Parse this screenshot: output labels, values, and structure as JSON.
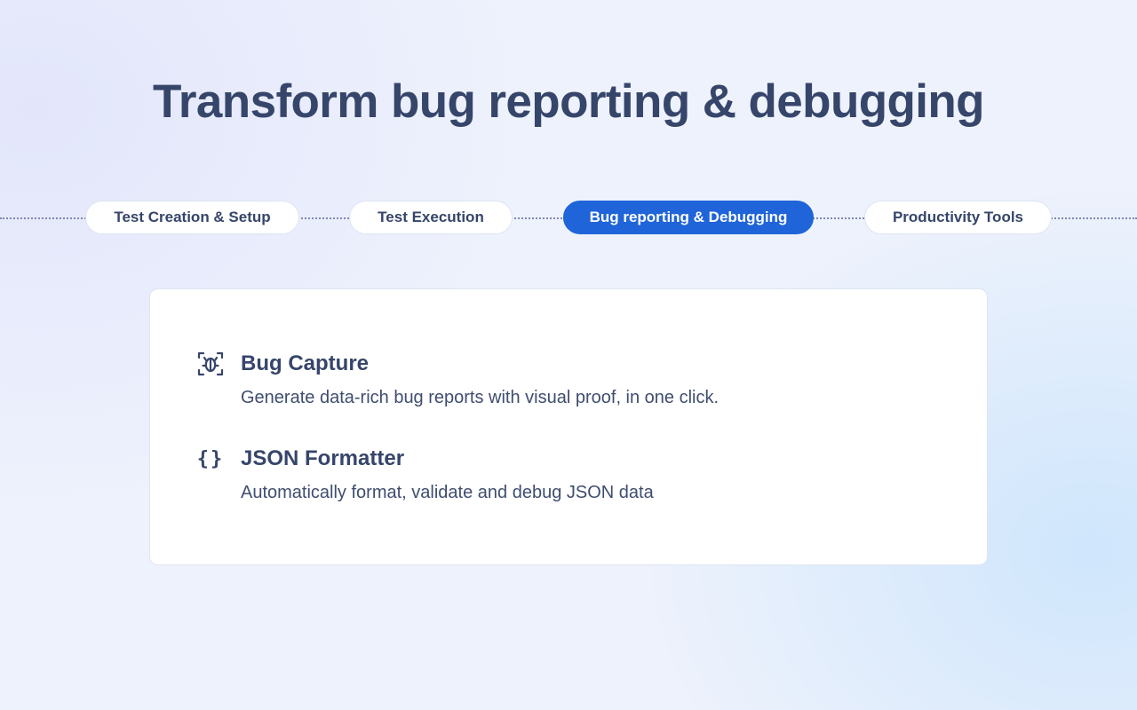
{
  "header": {
    "title": "Transform bug reporting & debugging"
  },
  "tabs": [
    {
      "label": "Test Creation & Setup",
      "active": false
    },
    {
      "label": "Test Execution",
      "active": false
    },
    {
      "label": "Bug reporting & Debugging",
      "active": true
    },
    {
      "label": "Productivity Tools",
      "active": false
    }
  ],
  "features": [
    {
      "icon": "bug-capture-icon",
      "title": "Bug Capture",
      "description": "Generate data-rich bug reports with visual proof, in one click."
    },
    {
      "icon": "braces-icon",
      "icon_glyph": "{}",
      "title": "JSON Formatter",
      "description": "Automatically format, validate and debug JSON data"
    }
  ],
  "colors": {
    "text": "#36456a",
    "accent": "#1f64d9",
    "card": "#ffffff"
  }
}
